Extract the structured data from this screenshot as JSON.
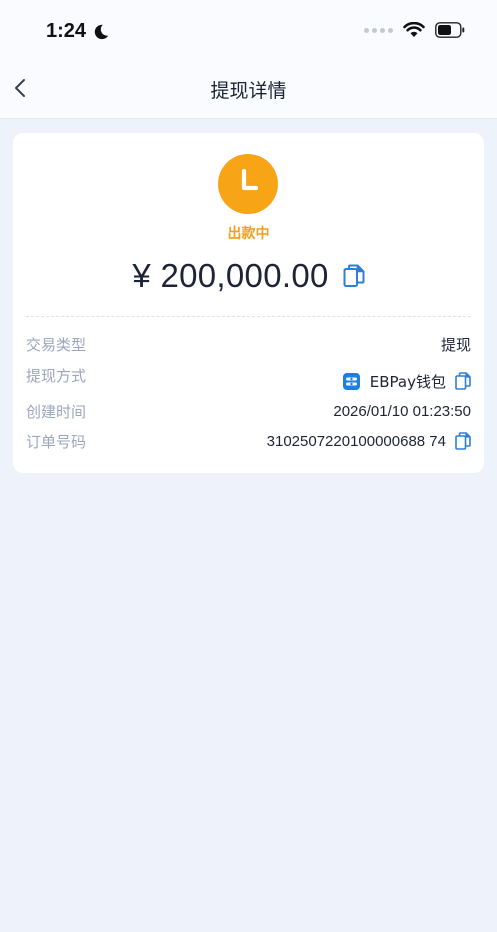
{
  "status_bar": {
    "time": "1:24"
  },
  "nav": {
    "title": "提现详情"
  },
  "detail": {
    "status": "出款中",
    "amount": "¥ 200,000.00",
    "rows": [
      {
        "label": "交易类型",
        "value": "提现"
      },
      {
        "label": "提现方式",
        "value": "EBPay钱包"
      },
      {
        "label": "创建时间",
        "value": "2026/01/10 01:23:50"
      },
      {
        "label": "订单号码",
        "value": "3102507220100000688 74"
      }
    ]
  },
  "icons": {
    "back": "chevron-left-icon",
    "status": "clock-icon",
    "copy": "copy-icon",
    "wallet": "ebpay-logo-icon"
  },
  "colors": {
    "accent": "#2f7fd8",
    "pending": "#f7a416",
    "background": "#eef3fb"
  }
}
